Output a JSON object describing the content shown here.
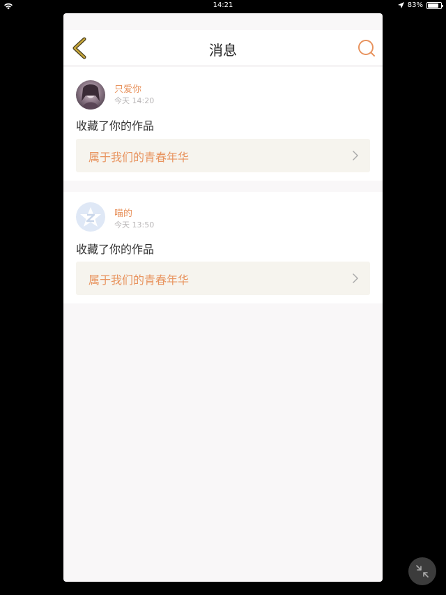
{
  "status_bar": {
    "time": "14:21",
    "battery": "83%",
    "battery_level": 0.83,
    "icons": [
      "wifi-icon",
      "location-arrow-icon",
      "battery-icon"
    ]
  },
  "header": {
    "title": "消息",
    "back_icon": "chevron-left-icon",
    "search_icon": "search-icon"
  },
  "notifications": [
    {
      "username": "只爱你",
      "time": "今天 14:20",
      "action": "收藏了你的作品",
      "work_title": "属于我们的青春年华",
      "avatar": "photo"
    },
    {
      "username": "喵的",
      "time": "今天 13:50",
      "action": "收藏了你的作品",
      "work_title": "属于我们的青春年华",
      "avatar": "default-qzone"
    }
  ],
  "colors": {
    "accent": "#e8935e",
    "back_icon": "#c9a83a",
    "link_background": "#f6f4ee",
    "page_background": "#f9f7f8"
  }
}
